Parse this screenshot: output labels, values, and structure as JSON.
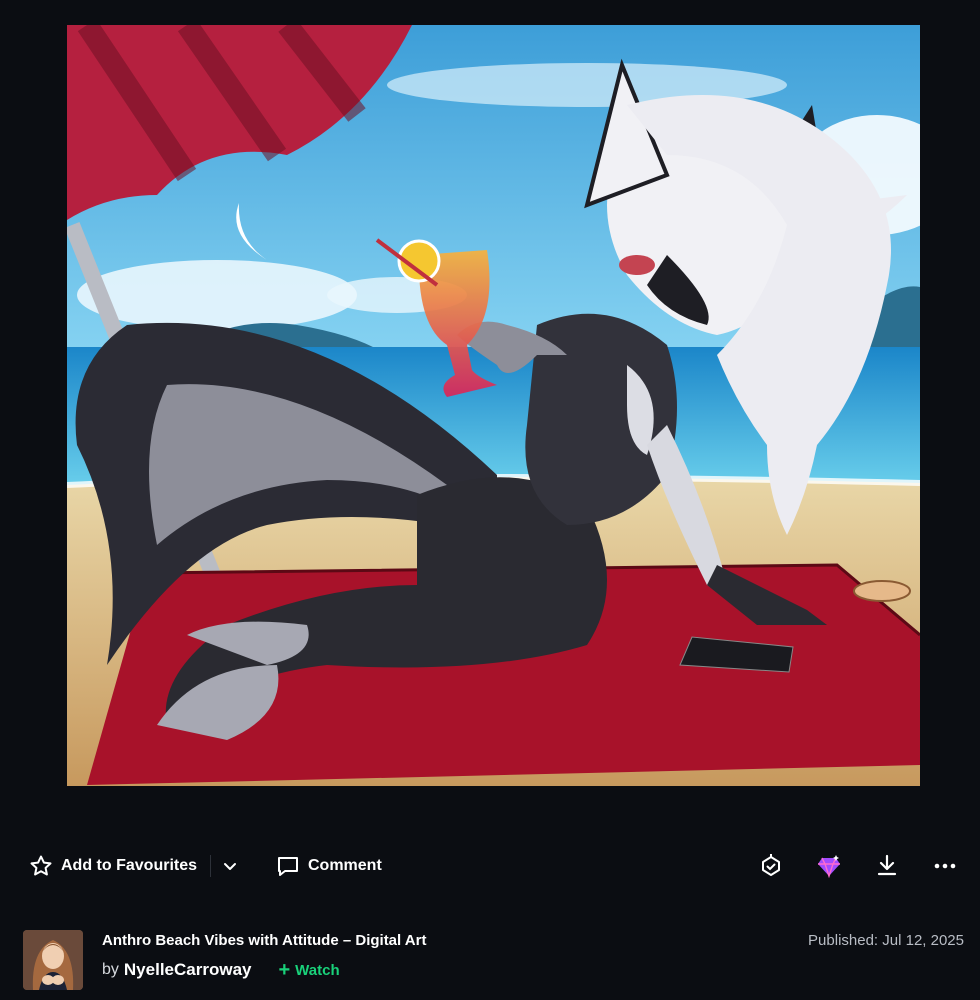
{
  "artwork": {
    "alt_icon": "artwork-image"
  },
  "actions": {
    "favourite_label": "Add to Favourites",
    "comment_label": "Comment",
    "icons": [
      "star-icon",
      "chevron-down-icon",
      "comment-icon",
      "badge-icon",
      "gem-icon",
      "download-icon",
      "more-icon"
    ],
    "gem_color": "#a24bff",
    "watch_color": "#19d17a"
  },
  "deviation": {
    "title": "Anthro Beach Vibes with Attitude – Digital Art",
    "by_label": "by",
    "author": "NyelleCarroway",
    "watch_label": "Watch",
    "published": "Published: Jul 12, 2025"
  }
}
